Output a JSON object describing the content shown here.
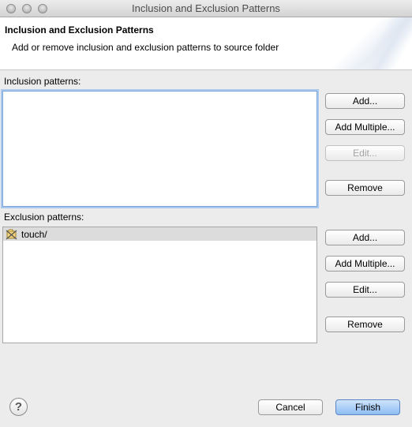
{
  "window": {
    "title": "Inclusion and Exclusion Patterns"
  },
  "banner": {
    "heading": "Inclusion and Exclusion Patterns",
    "description": "Add or remove inclusion and exclusion patterns to source folder"
  },
  "inclusion": {
    "label": "Inclusion patterns:",
    "items": [],
    "buttons": {
      "add": "Add...",
      "add_multiple": "Add Multiple...",
      "edit": "Edit...",
      "remove": "Remove"
    }
  },
  "exclusion": {
    "label": "Exclusion patterns:",
    "items": [
      {
        "label": "touch/"
      }
    ],
    "buttons": {
      "add": "Add...",
      "add_multiple": "Add Multiple...",
      "edit": "Edit...",
      "remove": "Remove"
    }
  },
  "footer": {
    "help": "?",
    "cancel": "Cancel",
    "finish": "Finish"
  },
  "icons": {
    "help": "help-icon",
    "exclusion_pattern": "exclusion-pattern-icon"
  }
}
